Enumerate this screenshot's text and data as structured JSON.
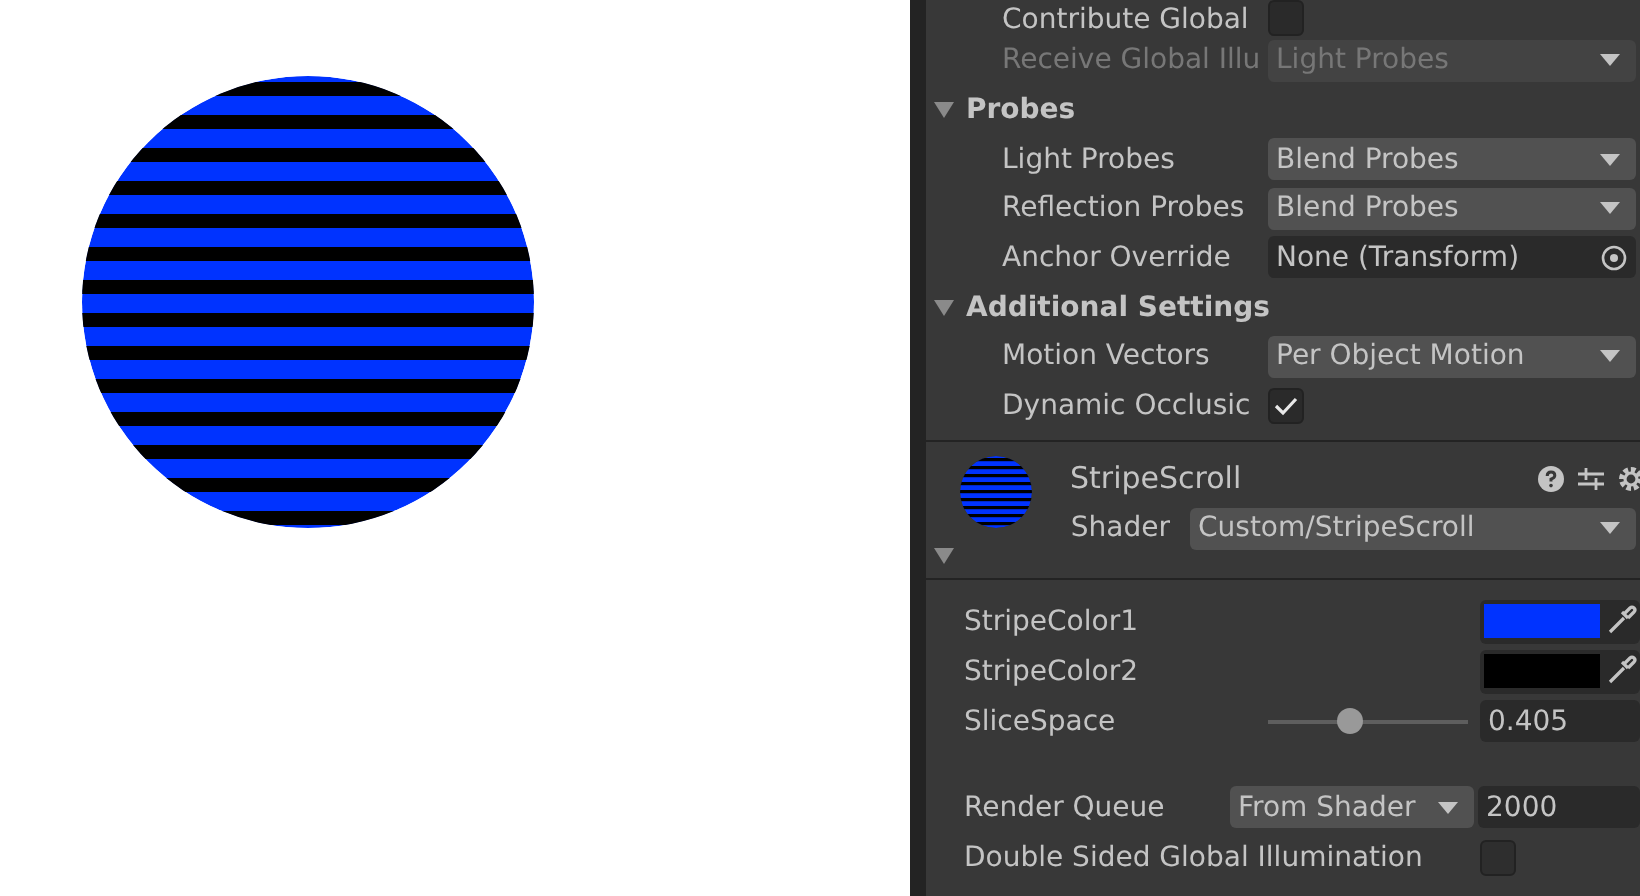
{
  "inspector_rows": [
    {
      "kind": "checkbox",
      "label": "Contribute Global",
      "checked": false,
      "disabled": false
    },
    {
      "kind": "dropdown",
      "label": "Receive Global Illu",
      "value": "Light Probes",
      "disabled": true
    },
    {
      "kind": "header",
      "label": "Probes",
      "expanded": true
    },
    {
      "kind": "dropdown",
      "label": "Light Probes",
      "value": "Blend Probes",
      "disabled": false
    },
    {
      "kind": "dropdown",
      "label": "Reflection Probes",
      "value": "Blend Probes",
      "disabled": false
    },
    {
      "kind": "object",
      "label": "Anchor Override",
      "value": "None (Transform)",
      "disabled": false
    },
    {
      "kind": "header",
      "label": "Additional Settings",
      "expanded": true
    },
    {
      "kind": "dropdown",
      "label": "Motion Vectors",
      "value": "Per Object Motion",
      "disabled": false
    },
    {
      "kind": "checkbox",
      "label": "Dynamic Occlusic",
      "checked": true,
      "disabled": false
    }
  ],
  "material": {
    "name": "StripeScroll",
    "expanded": true,
    "shader_label": "Shader",
    "shader": "Custom/StripeScroll",
    "properties": [
      {
        "kind": "color",
        "label": "StripeColor1",
        "color": "#0033ff"
      },
      {
        "kind": "color",
        "label": "StripeColor2",
        "color": "#000000"
      },
      {
        "kind": "slider",
        "label": "SliceSpace",
        "level": 0.41,
        "reading": "0.405"
      }
    ],
    "render_queue": {
      "label": "Render Queue",
      "mode": "From Shader",
      "value": "2000"
    },
    "double_sided": {
      "label": "Double Sided Global Illumination",
      "checked": false
    }
  }
}
